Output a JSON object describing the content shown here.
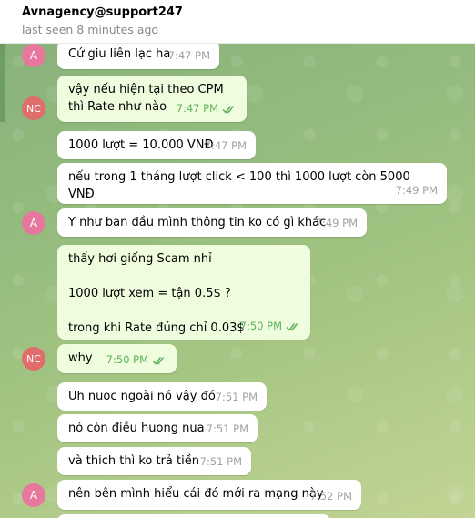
{
  "header": {
    "title": "Avnagency@support247",
    "status": "last seen 8 minutes ago"
  },
  "colors": {
    "outgoing_bubble": "#effdde",
    "incoming_bubble": "#ffffff",
    "check_color": "#5fb05b",
    "avatar_A": "#e8779e",
    "avatar_NC": "#e06c6c"
  },
  "avatars": {
    "a": "A",
    "nc": "NC"
  },
  "messages": [
    {
      "text": "Cứ giu liên lạc ha",
      "time": "7:47 PM",
      "direction": "in"
    },
    {
      "text": "vậy nếu hiện tại theo CPM\nthì Rate như nào",
      "time": "7:47 PM",
      "direction": "out",
      "read": true
    },
    {
      "text": "1000 lượt = 10.000 VNĐ",
      "time": "7:47 PM",
      "direction": "in"
    },
    {
      "text": "nếu trong 1 tháng lượt click < 100 thì 1000 lượt còn 5000 VNĐ",
      "time": "7:49 PM",
      "direction": "in"
    },
    {
      "text": "Y như ban đầu mình thông tin ko có gì khác",
      "time": "7:49 PM",
      "direction": "in"
    },
    {
      "text": "thấy hơi giống Scam nhỉ\n\n1000 lượt xem = tận 0.5$ ?\n\ntrong khi Rate đúng chỉ 0.03$",
      "time": "7:50 PM",
      "direction": "out",
      "read": true
    },
    {
      "text": "why",
      "time": "7:50 PM",
      "direction": "out",
      "read": true
    },
    {
      "text": "Uh nuoc ngoài nó vậy đó",
      "time": "7:51 PM",
      "direction": "in"
    },
    {
      "text": "nó còn điều huong nua",
      "time": "7:51 PM",
      "direction": "in"
    },
    {
      "text": "và thich thì ko trả tiền",
      "time": "7:51 PM",
      "direction": "in"
    },
    {
      "text": "nên bên mình hiểu cái đó mới ra mạng này",
      "time": "7:52 PM",
      "direction": "in"
    }
  ]
}
